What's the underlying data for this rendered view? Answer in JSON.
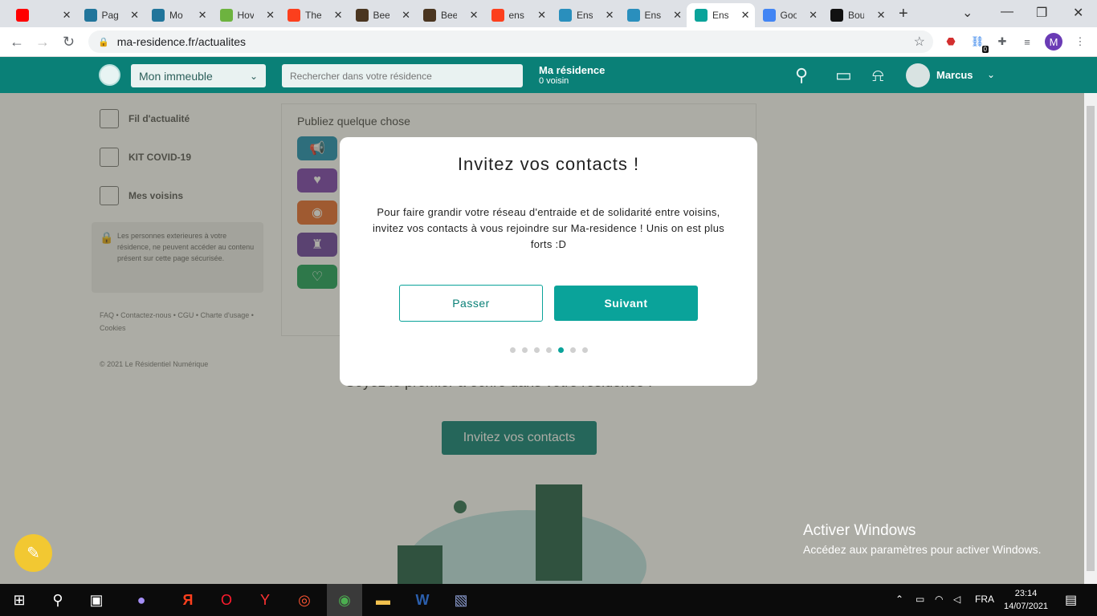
{
  "browser": {
    "tabs": [
      {
        "title": "",
        "icon": "youtube-icon",
        "color": "#ff0000"
      },
      {
        "title": "Pag",
        "icon": "wordpress-icon",
        "color": "#21759b"
      },
      {
        "title": "Mo",
        "icon": "wordpress-icon",
        "color": "#21759b"
      },
      {
        "title": "Hov",
        "icon": "leaf-icon",
        "color": "#6db33f"
      },
      {
        "title": "The",
        "icon": "yandex-icon",
        "color": "#fc3f1d"
      },
      {
        "title": "Bee",
        "icon": "image-icon",
        "color": "#4a3520"
      },
      {
        "title": "Bee",
        "icon": "image-icon",
        "color": "#4a3520"
      },
      {
        "title": "ens",
        "icon": "yandex-icon",
        "color": "#fc3f1d"
      },
      {
        "title": "Ens",
        "icon": "ma-residence-icon",
        "color": "#2a8fbd"
      },
      {
        "title": "Ens",
        "icon": "ma-residence-icon",
        "color": "#2a8fbd"
      },
      {
        "title": "Ens",
        "icon": "ma-residence-icon",
        "color": "#0aa39a"
      },
      {
        "title": "Goo",
        "icon": "google-translate-icon",
        "color": "#4285f4"
      },
      {
        "title": "Bou",
        "icon": "d-icon",
        "color": "#111111"
      }
    ],
    "url": "ma-residence.fr/actualites",
    "profile_initial": "M",
    "ext_badge": "0"
  },
  "header": {
    "building_select": "Mon immeuble",
    "search_placeholder": "Rechercher dans votre résidence",
    "residence_title": "Ma résidence",
    "neighbors_count": "0 voisin",
    "username": "Marcus"
  },
  "sidebar": {
    "items": [
      {
        "label": "Fil d'actualité",
        "icon": "feed-icon"
      },
      {
        "label": "KIT COVID-19",
        "icon": "clipboard-icon"
      },
      {
        "label": "Mes voisins",
        "icon": "people-icon"
      }
    ],
    "notice": "Les personnes exterieures à votre résidence, ne peuvent accéder au contenu présent sur cette page sécurisée.",
    "footer_links": "FAQ  • Contactez-nous  • CGU  • Charte d'usage  • Cookies",
    "copyright": "© 2021 Le Résidentiel Numérique"
  },
  "feed": {
    "publish_title": "Publiez quelque chose",
    "empty_text": "Soyez le premier à écrire dans votre résidence !",
    "invite_button": "Invitez vos contacts"
  },
  "modal": {
    "title": "Invitez vos contacts !",
    "body": "Pour faire grandir votre réseau d'entraide et de solidarité entre voisins, invitez vos contacts à vous rejoindre sur Ma-residence ! Unis on est plus forts :D",
    "skip_label": "Passer",
    "next_label": "Suivant",
    "steps_total": 7,
    "step_current": 5
  },
  "watermark": {
    "title": "Activer Windows",
    "subtitle": "Accédez aux paramètres pour activer Windows."
  },
  "taskbar": {
    "language": "FRA",
    "time": "23:14",
    "date": "14/07/2021"
  },
  "colors": {
    "brand": "#0a8077",
    "accent": "#0aa39a"
  }
}
